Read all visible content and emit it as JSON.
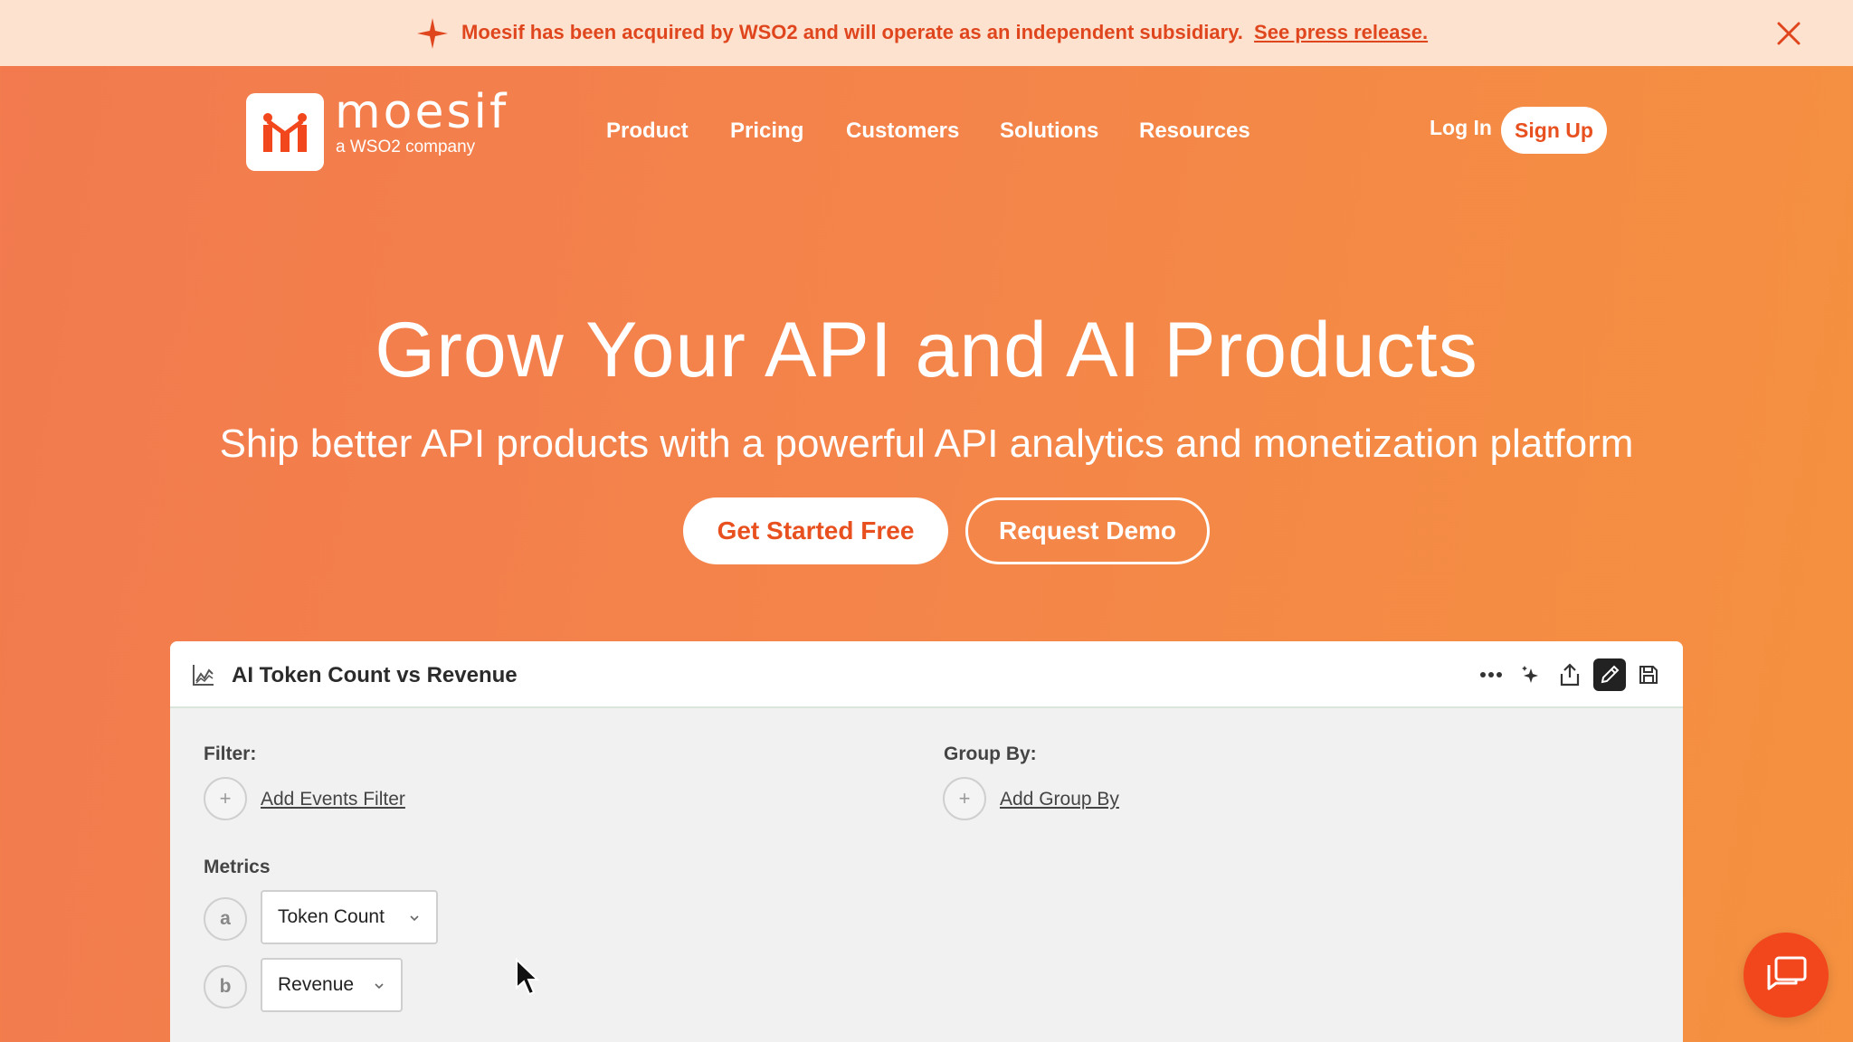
{
  "banner": {
    "message": "Moesif has been acquired by WSO2 and will operate as an independent subsidiary.",
    "link": "See press release."
  },
  "logo": {
    "wordmark": "moesif",
    "tagline": "a WSO2 company"
  },
  "nav": {
    "items": [
      "Product",
      "Pricing",
      "Customers",
      "Solutions",
      "Resources"
    ],
    "login": "Log In",
    "signup": "Sign Up"
  },
  "hero": {
    "title": "Grow Your API and AI Products",
    "subtitle": "Ship better API products with a powerful API analytics and monetization platform",
    "primary_cta": "Get Started Free",
    "secondary_cta": "Request Demo"
  },
  "dashboard": {
    "title": "AI Token Count vs Revenue",
    "filter_label": "Filter:",
    "filter_link": "Add Events Filter",
    "groupby_label": "Group By:",
    "groupby_link": "Add Group By",
    "metrics_label": "Metrics",
    "metrics": [
      {
        "letter": "a",
        "value": "Token Count"
      },
      {
        "letter": "b",
        "value": "Revenue"
      }
    ]
  },
  "colors": {
    "brand": "#f2461c",
    "banner_bg": "#fde2cf",
    "accent_text": "#e0461e"
  }
}
